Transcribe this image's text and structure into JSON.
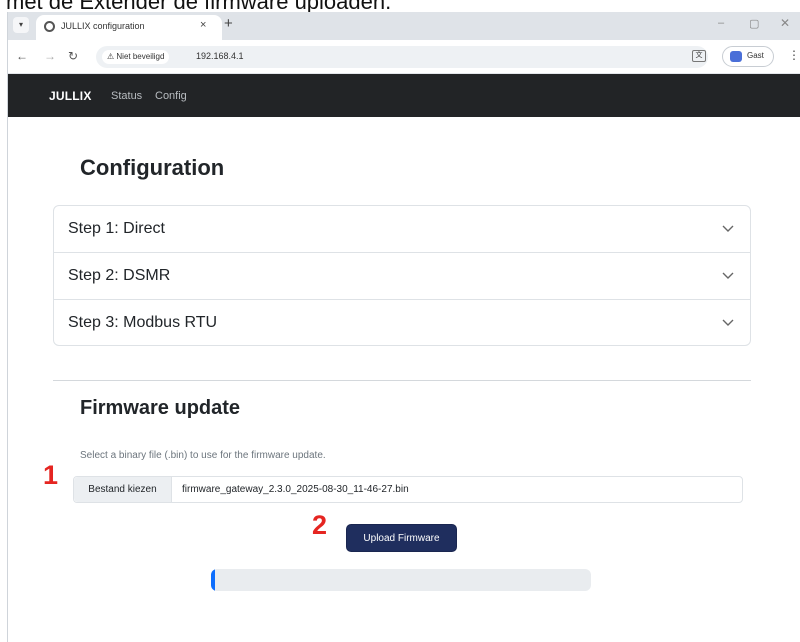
{
  "caption": "met de Extender de firmware uploaden.",
  "browser": {
    "tab_title": "JULLIX configuration",
    "tab_close": "×",
    "new_tab": "+",
    "window_controls": {
      "minimize": "–",
      "maximize": "▢",
      "close": "✕"
    },
    "security_label": "⚠ Niet beveiligd",
    "url": "192.168.4.1",
    "profile_label": "Gast",
    "menu": "⋮"
  },
  "navbar": {
    "brand": "JULLIX",
    "links": [
      "Status",
      "Config"
    ]
  },
  "page": {
    "title": "Configuration",
    "steps": [
      {
        "label": "Step 1: Direct"
      },
      {
        "label": "Step 2: DSMR"
      },
      {
        "label": "Step 3: Modbus RTU"
      }
    ]
  },
  "firmware": {
    "title": "Firmware update",
    "help_text": "Select a binary file (.bin) to use for the firmware update.",
    "choose_file_label": "Bestand kiezen",
    "file_name": "firmware_gateway_2.3.0_2025-08-30_11-46-27.bin",
    "upload_label": "Upload Firmware",
    "progress_percent": 1
  },
  "annotations": {
    "marker_1": "1",
    "marker_2": "2"
  },
  "colors": {
    "navbar_bg": "#222426",
    "upload_button": "#1f2e5e",
    "progress_fill": "#0d6efd",
    "marker": "#e52521"
  },
  "icons": {
    "tab_favicon": "globe-icon",
    "back": "arrow-left-icon",
    "forward": "arrow-right-icon",
    "reload": "reload-icon",
    "translate": "translate-icon",
    "chevron": "chevron-down-icon"
  }
}
